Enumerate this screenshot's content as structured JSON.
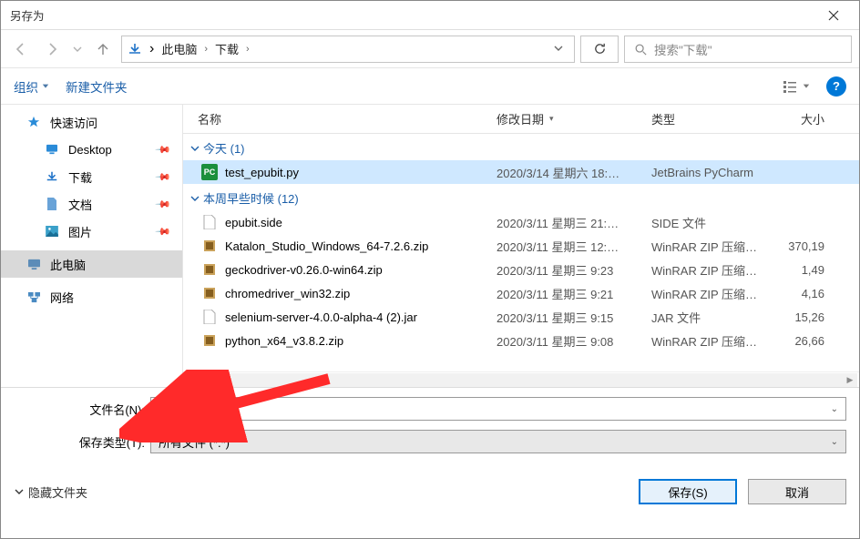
{
  "window": {
    "title": "另存为"
  },
  "nav": {
    "crumbs": [
      "此电脑",
      "下载"
    ],
    "search_placeholder": "搜索\"下载\""
  },
  "toolbar": {
    "organize": "组织",
    "newfolder": "新建文件夹"
  },
  "sidebar": {
    "quick": "快速访问",
    "desktop": "Desktop",
    "downloads": "下载",
    "documents": "文档",
    "pictures": "图片",
    "thispc": "此电脑",
    "network": "网络"
  },
  "columns": {
    "name": "名称",
    "date": "修改日期",
    "type": "类型",
    "size": "大小"
  },
  "groups": {
    "today": {
      "label": "今天 (1)"
    },
    "earlier": {
      "label": "本周早些时候 (12)"
    }
  },
  "files": [
    {
      "group": "today",
      "icon": "py",
      "name": "test_epubit.py",
      "date": "2020/3/14 星期六 18:…",
      "type": "JetBrains PyCharm",
      "size": "",
      "selected": true
    },
    {
      "group": "earlier",
      "icon": "doc",
      "name": "epubit.side",
      "date": "2020/3/11 星期三 21:…",
      "type": "SIDE 文件",
      "size": "",
      "selected": false
    },
    {
      "group": "earlier",
      "icon": "zip",
      "name": "Katalon_Studio_Windows_64-7.2.6.zip",
      "date": "2020/3/11 星期三 12:…",
      "type": "WinRAR ZIP 压缩…",
      "size": "370,19",
      "selected": false
    },
    {
      "group": "earlier",
      "icon": "zip",
      "name": "geckodriver-v0.26.0-win64.zip",
      "date": "2020/3/11 星期三 9:23",
      "type": "WinRAR ZIP 压缩…",
      "size": "1,49",
      "selected": false
    },
    {
      "group": "earlier",
      "icon": "zip",
      "name": "chromedriver_win32.zip",
      "date": "2020/3/11 星期三 9:21",
      "type": "WinRAR ZIP 压缩…",
      "size": "4,16",
      "selected": false
    },
    {
      "group": "earlier",
      "icon": "doc",
      "name": "selenium-server-4.0.0-alpha-4 (2).jar",
      "date": "2020/3/11 星期三 9:15",
      "type": "JAR 文件",
      "size": "15,26",
      "selected": false
    },
    {
      "group": "earlier",
      "icon": "zip",
      "name": "python_x64_v3.8.2.zip",
      "date": "2020/3/11 星期三 9:08",
      "type": "WinRAR ZIP 压缩…",
      "size": "26,66",
      "selected": false
    }
  ],
  "fields": {
    "filename_label": "文件名(N):",
    "filename_value": "test_epubit.py",
    "filetype_label": "保存类型(T):",
    "filetype_value": "所有文件 (*.*)"
  },
  "actions": {
    "hidefolders": "隐藏文件夹",
    "save": "保存(S)",
    "cancel": "取消"
  },
  "annotation": {
    "arrow_color": "#ff2a2a"
  }
}
